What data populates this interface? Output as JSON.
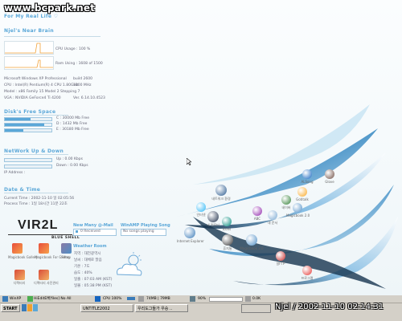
{
  "watermark": "www.bcpark.net",
  "header": {
    "tagline": "For My Real Life",
    "title": "Njel's Near Brain"
  },
  "system": {
    "cpu_label": "CPU Usage : 100 %",
    "ram_label": "Ram Using : 1608 of 1500",
    "os": "Microsoft Windows XP Professional",
    "os_build": "build 2600",
    "cpu": "CPU : Intel(R) Pentium(R) 4 CPU 1.80GHz",
    "cpu_speed": "1800 MHz",
    "model": "Model : x86 Family 15 Model 2 Stepping 7",
    "vga": "VGA : NVIDIA GeForce4 Ti 4200",
    "vga_ver": "Ver. 6.14.10.4523"
  },
  "disk": {
    "title": "Disk's Free Space",
    "drives": [
      {
        "label": "C : 30000 Mb Free",
        "used": 0.55
      },
      {
        "label": "D : 1432 Mb Free",
        "used": 0.85
      },
      {
        "label": "E : 30180 Mb Free",
        "used": 0.4
      }
    ]
  },
  "network": {
    "title": "NetWork Up & Down",
    "up": "Up : 0.00 Kbps",
    "down": "Down : 0.00 Kbps",
    "ip_label": "IP Address :"
  },
  "datetime": {
    "title": "Date & Time",
    "current": "Current Time : 2002-11-10 일 02:05:56",
    "process": "Process Time : 1일 18시간 11분 22초"
  },
  "logo": {
    "main": "VIR2L",
    "sub": "BLUE SHELL"
  },
  "mail": {
    "title": "New Many @-Mail",
    "status": "0 Received"
  },
  "winamp": {
    "title": "WinAMP Playing Song",
    "status": "No songs playing"
  },
  "weather": {
    "title": "Weather Room",
    "lines": [
      "지역 : 대전광역시",
      "날씨 : 대체로 맑음",
      "기온 : 7도",
      "습도 : 40%",
      "일출 : 07:03 AM (KST)",
      "일몰 : 05:38 PM (KST)"
    ]
  },
  "left_icons": [
    {
      "label": "Magicbook Gallery"
    },
    {
      "label": "Magicbook For Gallery"
    },
    {
      "label": "Setup"
    },
    {
      "label": "디렉터리"
    },
    {
      "label": "디렉터리 사진관리"
    }
  ],
  "desktop_icons": [
    {
      "label": "Internet Explorer"
    },
    {
      "label": "내 컴퓨터"
    },
    {
      "label": "네트워크 환경"
    },
    {
      "label": "Magicbook 2.0"
    },
    {
      "label": "휴지통"
    },
    {
      "label": "내 문서"
    },
    {
      "label": "네이버"
    },
    {
      "label": "알FTP"
    },
    {
      "label": "Gotitalk"
    },
    {
      "label": "ALSong"
    },
    {
      "label": "Glove"
    },
    {
      "label": "Magicbook 2.0"
    },
    {
      "label": "프로그램"
    },
    {
      "label": "인터넷"
    },
    {
      "label": "ABC"
    },
    {
      "label": "Icons"
    }
  ],
  "taskbar": {
    "start": "START",
    "buttons": [
      {
        "label": "WinXP"
      },
      {
        "label": "HiEditEff[files] No All"
      },
      {
        "label": "CPU 100%"
      },
      {
        "label": "74MB | 79MB"
      },
      {
        "label": "90%"
      },
      {
        "label": "0.0K"
      },
      {
        "label": "UNTITLE2002"
      },
      {
        "label": "우리도그들가 우승 .."
      }
    ],
    "clock": "Njel / 2002-11-10 02:14:31"
  }
}
